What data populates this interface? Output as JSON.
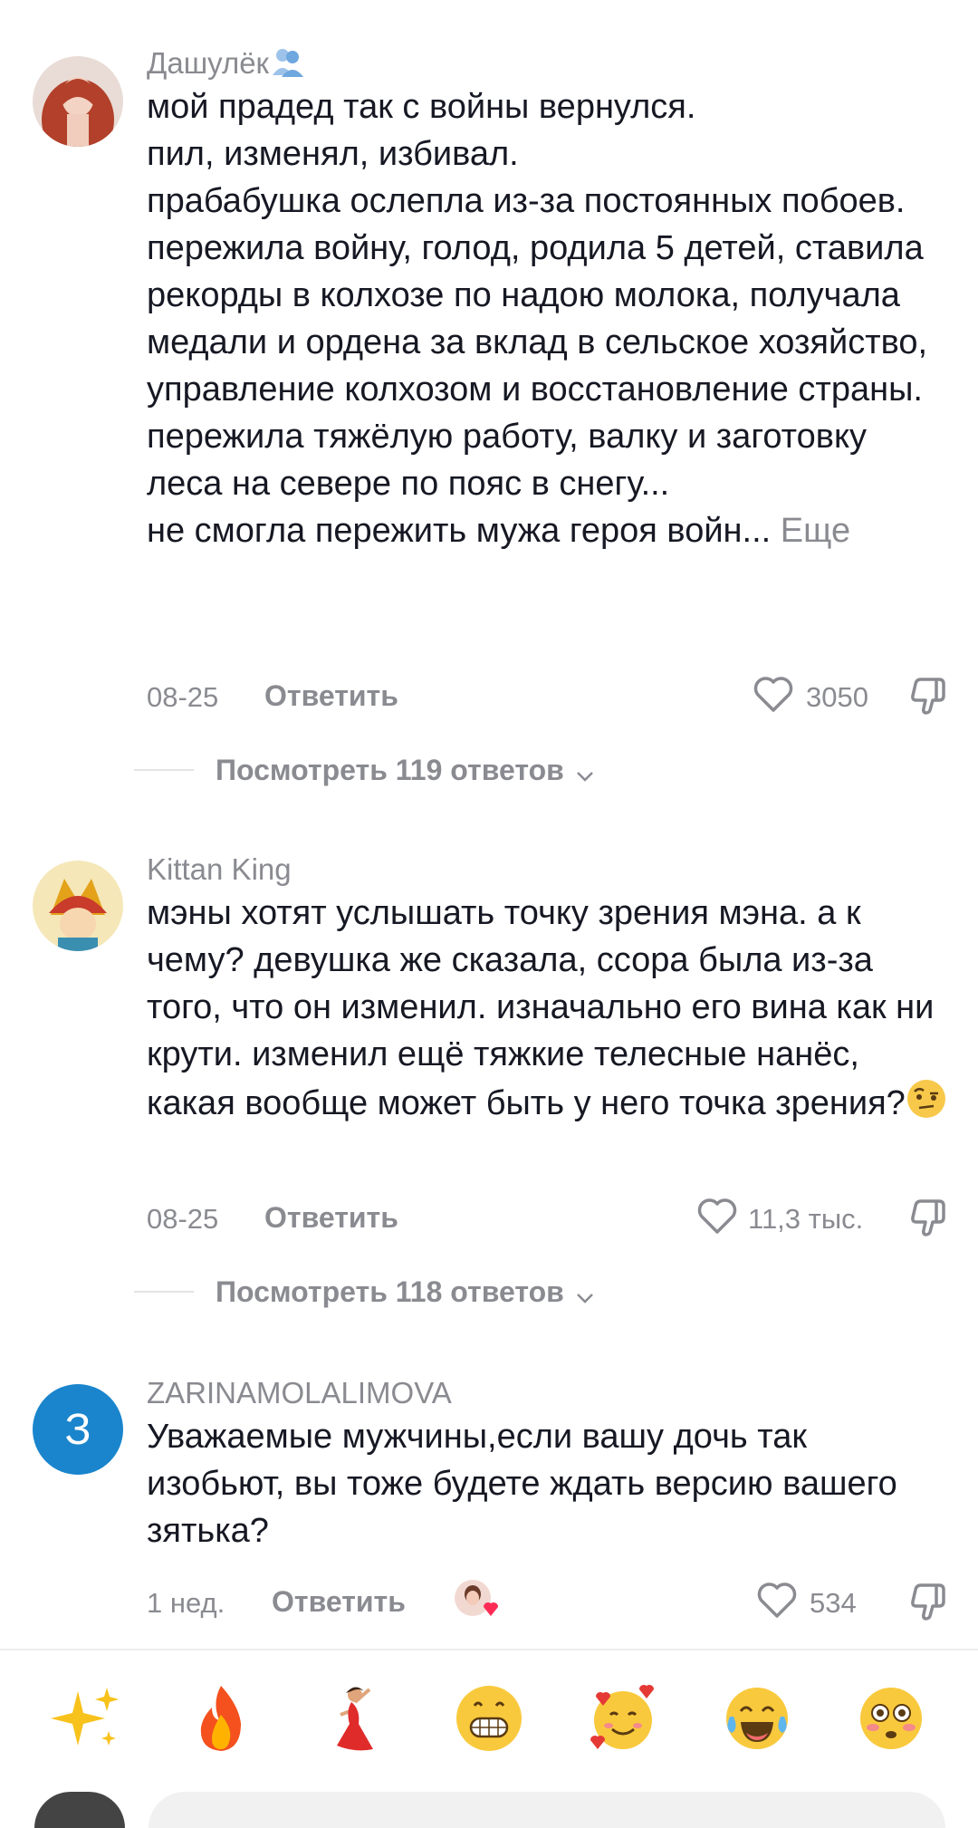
{
  "comments": [
    {
      "username": "Дашулёк",
      "text": "мой прадед так с войны вернулся.\nпил, изменял, избивал.\nпрабабушка ослепла из-за постоянных побоев.\nпережила войну, голод, родила 5 детей, ставила рекорды в колхозе по надою молока, получала медали и ордена за вклад в сельское хозяйство, управление колхозом и восстановление страны. пережила тяжёлую работу, валку и заготовку леса на севере по пояс в снегу...\nне смогла пережить мужа героя войн...",
      "more_label": "Еще",
      "date": "08-25",
      "reply_label": "Ответить",
      "likes": "3050",
      "replies_label": "Посмотреть 119 ответов"
    },
    {
      "username": "Kittan King",
      "text": "мэны хотят услышать точку зрения мэна. а к чему? девушка же сказала, ссора была из-за того, что он изменил. изначально его вина как ни крути. изменил ещё тяжкие телесные нанёс, какая вообще может быть у него точка зрения?",
      "date": "08-25",
      "reply_label": "Ответить",
      "likes": "11,3 тыс.",
      "replies_label": "Посмотреть 118 ответов"
    },
    {
      "username": "ZARINAMOLALIMOVA",
      "avatar_letter": "З",
      "text": "Уважаемые мужчины,если вашу дочь так изобьют, вы тоже будете ждать версию вашего зятька?",
      "date": "1 нед.",
      "reply_label": "Ответить",
      "likes": "534"
    }
  ],
  "emoji_bar": [
    "sparkles",
    "fire",
    "dancer",
    "grinning-face",
    "smiling-face-with-hearts",
    "tears-of-joy",
    "flushed-face"
  ],
  "colors": {
    "text": "#161823",
    "muted": "#8a8b91",
    "avatar3_bg": "#1a85cc"
  }
}
